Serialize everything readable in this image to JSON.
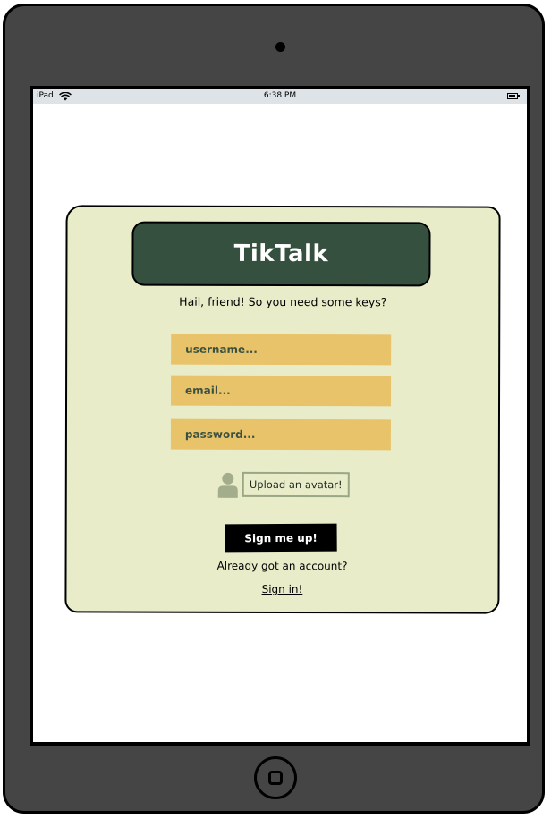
{
  "status_bar": {
    "carrier": "iPad",
    "time": "6:38 PM",
    "wifi_icon": "wifi-icon",
    "battery_icon": "battery-icon"
  },
  "app": {
    "logo": "TikTalk",
    "tagline": "Hail, friend! So you need some keys?",
    "fields": {
      "username_placeholder": "username...",
      "email_placeholder": "email...",
      "password_placeholder": "password..."
    },
    "avatar_icon": "person-icon",
    "upload_label": "Upload an avatar!",
    "signup_label": "Sign me up!",
    "already_text": "Already got an account?",
    "signin_label": "Sign in!"
  },
  "colors": {
    "card_bg": "#e8ecc9",
    "logo_bg": "#35503f",
    "field_bg": "#e8c36a",
    "field_text": "#3a5040",
    "device_frame": "#454545"
  }
}
